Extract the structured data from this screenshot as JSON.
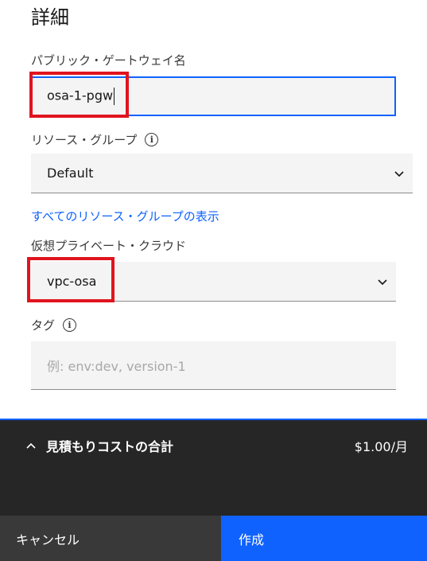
{
  "section": {
    "title": "詳細"
  },
  "gateway_name": {
    "label": "パブリック・ゲートウェイ名",
    "value": "osa-1-pgw"
  },
  "resource_group": {
    "label": "リソース・グループ",
    "value": "Default",
    "link": "すべてのリソース・グループの表示"
  },
  "vpc": {
    "label": "仮想プライベート・クラウド",
    "value": "vpc-osa"
  },
  "tags": {
    "label": "タグ",
    "placeholder": "例: env:dev, version-1"
  },
  "cost": {
    "label": "見積もりコストの合計",
    "value": "$1.00/月"
  },
  "actions": {
    "cancel": "キャンセル",
    "create": "作成"
  },
  "colors": {
    "accent": "#0f62fe",
    "highlight": "#e0141e",
    "panel": "#262626"
  }
}
